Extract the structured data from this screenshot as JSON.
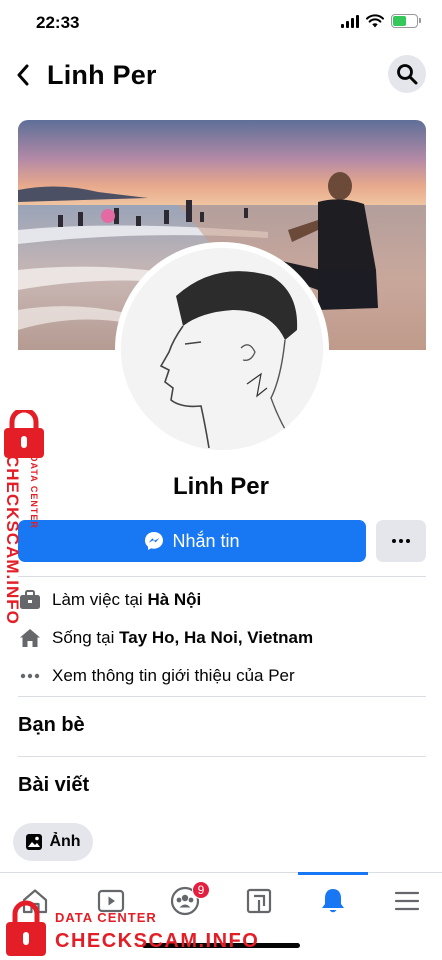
{
  "status_bar": {
    "time": "22:33"
  },
  "header": {
    "title": "Linh Per",
    "back_icon": "chevron-left-icon",
    "search_icon": "search-icon"
  },
  "profile": {
    "name": "Linh Per",
    "message_button": "Nhắn tin"
  },
  "intro": {
    "work_prefix": "Làm việc tại ",
    "work_place": "Hà Nội",
    "live_prefix": "Sống tại ",
    "live_place": "Tay Ho, Ha Noi, Vietnam",
    "see_more": "Xem thông tin giới thiệu của Per"
  },
  "sections": {
    "friends": "Bạn bè",
    "posts": "Bài viết"
  },
  "photos_chip": {
    "label": "Ảnh"
  },
  "bottom_nav": {
    "items": [
      {
        "icon": "home-icon"
      },
      {
        "icon": "watch-icon"
      },
      {
        "icon": "groups-icon",
        "badge": "9"
      },
      {
        "icon": "gaming-icon"
      },
      {
        "icon": "bell-icon",
        "active": true
      },
      {
        "icon": "menu-icon"
      }
    ]
  },
  "watermark": {
    "brand": "CHECKSCAM.INFO",
    "sub": "DATA CENTER"
  },
  "colors": {
    "accent": "#1877f2",
    "badge": "#e41e3f",
    "watermark": "#e41e26"
  }
}
